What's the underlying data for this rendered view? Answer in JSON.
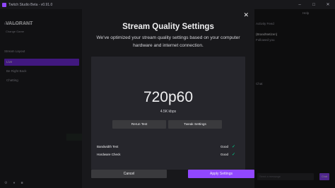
{
  "window": {
    "title": "Twitch Studio Beta - v0.91.0"
  },
  "left_panel": {
    "header": "Main Stream Scene",
    "game_title": "VALORANT",
    "game_sub": "Change Game",
    "scene_heading": "Stream Layout",
    "scenes": [
      "Live",
      "Be Right Back",
      "Chatting"
    ]
  },
  "right_panel": {
    "help": "Help",
    "activity_header": "Activity Feed",
    "follower_name": "(BrandNetizen)",
    "follower_sub": "Followed you",
    "chat_header": "Chat",
    "chat_placeholder": "Send a message",
    "chat_button": "Chat"
  },
  "modal": {
    "title": "Stream Quality Settings",
    "description": "We've optimized your stream quality settings based on your computer hardware and internet connection.",
    "quality": "720p60",
    "bitrate": "4.5K kbps",
    "rerun_label": "Rerun Test",
    "tweak_label": "Tweak Settings",
    "checks": [
      {
        "label": "Bandwidth Test",
        "status": "Good"
      },
      {
        "label": "Hardware Check",
        "status": "Good"
      }
    ],
    "cancel_label": "Cancel",
    "apply_label": "Apply Settings"
  },
  "colors": {
    "accent": "#9147ff",
    "good": "#00d68f",
    "modal_bg": "#18181b"
  }
}
